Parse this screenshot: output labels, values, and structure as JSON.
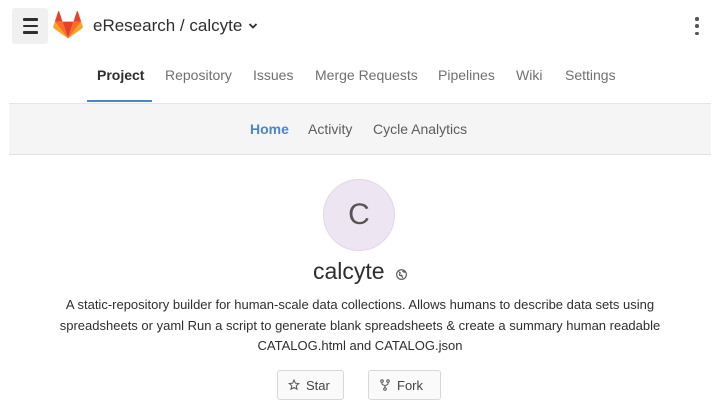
{
  "header": {
    "title": "eResearch / calcyte",
    "menu_icon": "hamburger-menu-icon",
    "logo": "gitlab-logo",
    "more_icon": "vertical-ellipsis-icon"
  },
  "project_nav": {
    "tabs": [
      {
        "label": "Project",
        "active": true
      },
      {
        "label": "Repository"
      },
      {
        "label": "Issues"
      },
      {
        "label": "Merge Requests"
      },
      {
        "label": "Pipelines"
      },
      {
        "label": "Wiki"
      },
      {
        "label": "Settings"
      }
    ]
  },
  "sub_nav": {
    "tabs": [
      {
        "label": "Home",
        "active": true
      },
      {
        "label": "Activity"
      },
      {
        "label": "Cycle Analytics"
      }
    ]
  },
  "project": {
    "avatar_letter": "C",
    "name": "calcyte",
    "visibility_icon": "globe-icon",
    "description_lines": [
      "A static-repository builder for human-scale data collections. Allows humans to describe data sets using",
      "spreadsheets or yaml Run a script to generate blank spreadsheets & create a summary human readable",
      "CATALOG.html and CATALOG.json"
    ]
  },
  "actions": {
    "star_label": "Star",
    "fork_label": "Fork"
  },
  "colors": {
    "accent": "#4a86c8",
    "avatar_bg": "#eee5f2",
    "subnav_bg": "#f5f5f5"
  }
}
